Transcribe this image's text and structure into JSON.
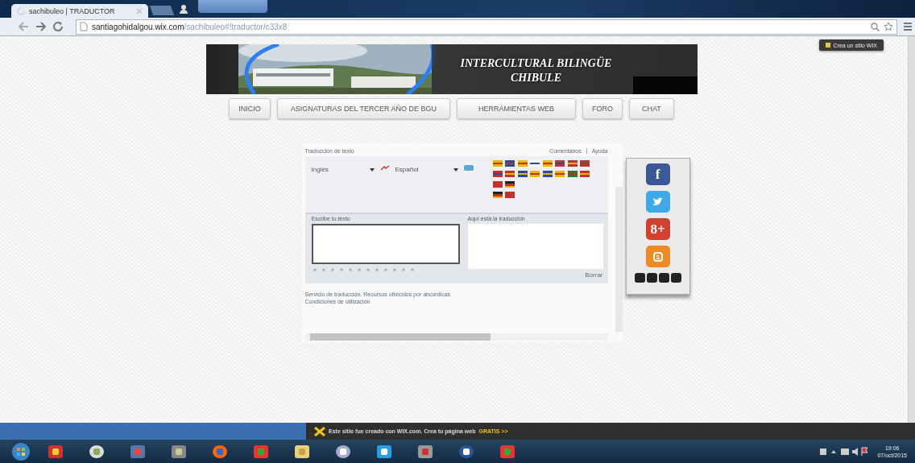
{
  "browser": {
    "tab_title": "sachibuleo | TRADUCTOR",
    "url_host": "santiagohidalgou.wix.com",
    "url_path": "/sachibuleo#!traductor/c33x8"
  },
  "wix_badge": "Crea un sitio WIX",
  "banner": {
    "title_line1": "INTERCULTURAL BILINGÜE",
    "title_line2": "CHIBULE"
  },
  "nav": [
    {
      "label": "INICIO"
    },
    {
      "label": "ASIGNATURAS DEL TERCER AÑO DE BGU"
    },
    {
      "label": "HERRAMIENTAS WEB"
    },
    {
      "label": "FORO"
    },
    {
      "label": "CHAT"
    }
  ],
  "translator": {
    "title": "Traducción de texto",
    "links": [
      "Comentarios",
      "Ayuda"
    ],
    "source_language": "Inglés",
    "target_language": "Español",
    "input_label": "Escribe tu texto",
    "output_label": "Aquí está la traducción",
    "clear": "Borrar",
    "footer": [
      "Servicio de traducción. Recursos ofrecidos por abcordicas",
      "Condiciones de utilización"
    ]
  },
  "social": [
    {
      "kind": "facebook",
      "glyph": "f"
    },
    {
      "kind": "twitter"
    },
    {
      "kind": "googleplus",
      "glyph": "8+"
    },
    {
      "kind": "blogger"
    }
  ],
  "wix_banner": {
    "text": "Este sitio fue creado con WIX.com. Crea tu página web",
    "link": "GRATIS >>"
  },
  "clock": {
    "time": "19:06",
    "date": "07/oct/2015"
  }
}
